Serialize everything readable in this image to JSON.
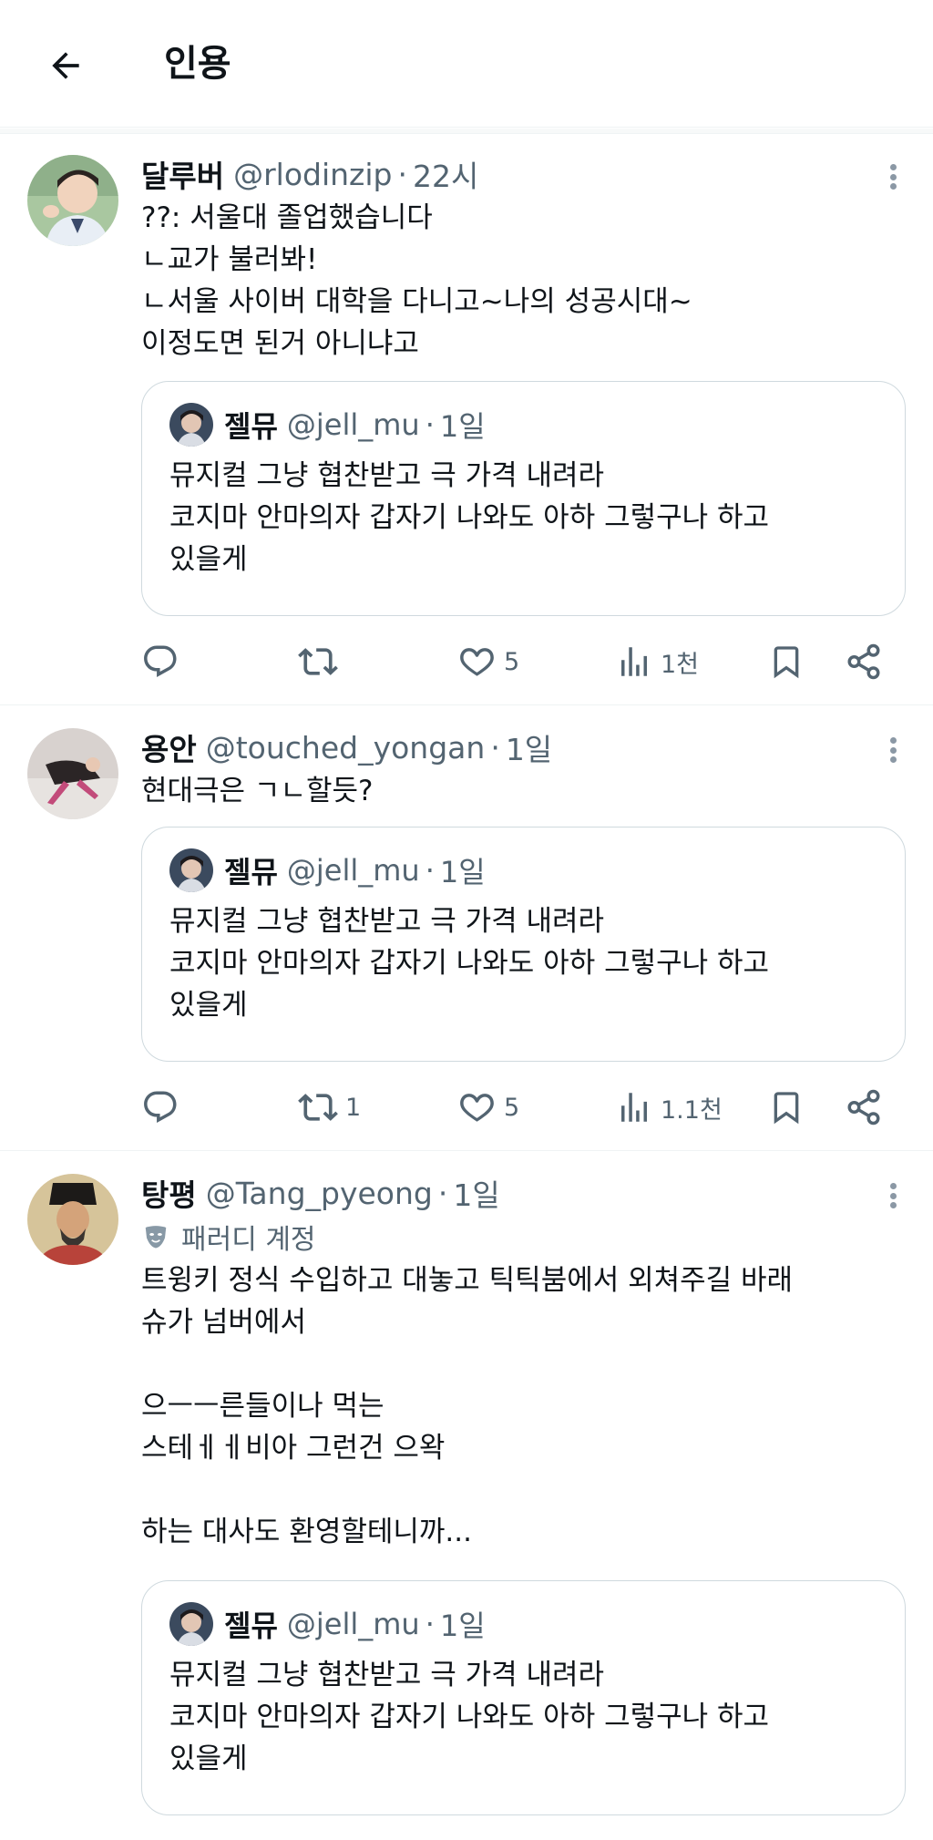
{
  "header": {
    "title": "인용"
  },
  "tweets": [
    {
      "name": "달루버",
      "handle": "@rlodinzip",
      "dot": "·",
      "time": "22시",
      "text": "??: 서울대 졸업했습니다\nㄴ교가 불러봐!\nㄴ서울 사이버 대학을 다니고~나의 성공시대~\n이정도면 된거 아니냐고",
      "quote": {
        "name": "젤뮤",
        "handle": "@jell_mu",
        "dot": "·",
        "time": "1일",
        "text": "뮤지컬 그냥 협찬받고 극 가격 내려라\n코지마 안마의자 갑자기 나와도 아하 그렇구나 하고\n있을게"
      },
      "actions": {
        "reply": "",
        "retweet": "",
        "like": "5",
        "views": "1천"
      }
    },
    {
      "name": "용안",
      "handle": "@touched_yongan",
      "dot": "·",
      "time": "1일",
      "text": "현대극은 ㄱㄴ할듯?",
      "quote": {
        "name": "젤뮤",
        "handle": "@jell_mu",
        "dot": "·",
        "time": "1일",
        "text": "뮤지컬 그냥 협찬받고 극 가격 내려라\n코지마 안마의자 갑자기 나와도 아하 그렇구나 하고\n있을게"
      },
      "actions": {
        "reply": "",
        "retweet": "1",
        "like": "5",
        "views": "1.1천"
      }
    },
    {
      "name": "탕평",
      "handle": "@Tang_pyeong",
      "dot": "·",
      "time": "1일",
      "label": "패러디 계정",
      "text": "트윙키 정식 수입하고 대놓고 틱틱붐에서 외쳐주길 바래\n슈가 넘버에서\n\n으ㅡㅡ른들이나 먹는\n스테ㅔㅔ비아 그런건 으왁\n\n하는 대사도 환영할테니까...",
      "quote": {
        "name": "젤뮤",
        "handle": "@jell_mu",
        "dot": "·",
        "time": "1일",
        "text": "뮤지컬 그냥 협찬받고 극 가격 내려라\n코지마 안마의자 갑자기 나와도 아하 그렇구나 하고\n있을게"
      }
    }
  ],
  "icons": {
    "back": "arrow-left-icon",
    "more": "more-vertical-icon",
    "reply": "reply-icon",
    "retweet": "retweet-icon",
    "like": "heart-icon",
    "views": "views-chart-icon",
    "bookmark": "bookmark-icon",
    "share": "share-icon",
    "parody": "parody-mask-icon"
  },
  "colors": {
    "text": "#0f1419",
    "secondary": "#536471",
    "border": "#cfd9de"
  }
}
